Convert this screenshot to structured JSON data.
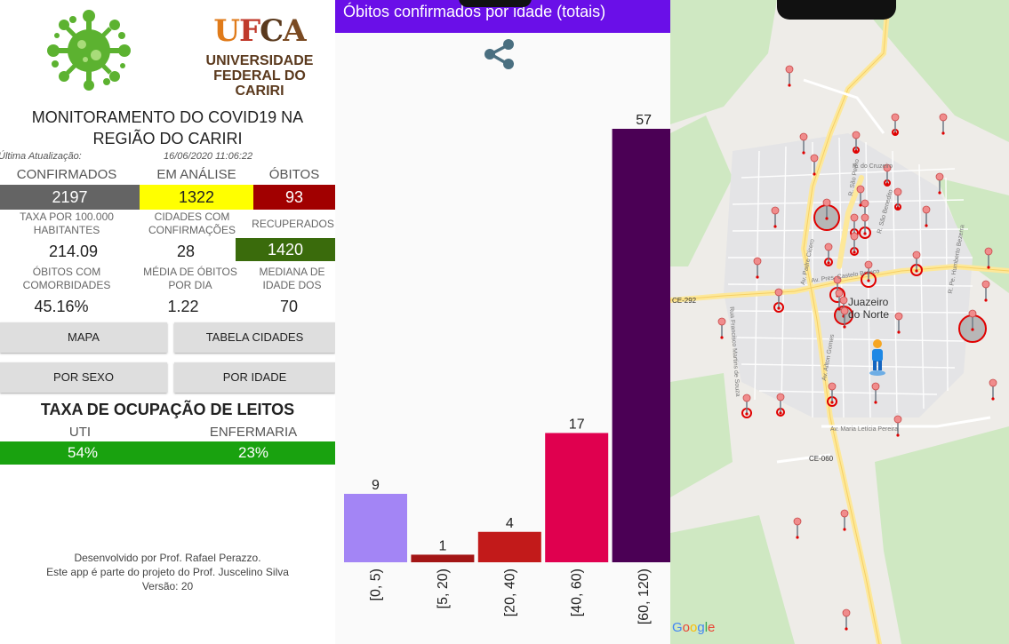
{
  "home": {
    "university_logo_text": "UFCA",
    "university_name_line1": "UNIVERSIDADE",
    "university_name_line2": "FEDERAL DO CARIRI",
    "title_line1": "MONITORAMENTO DO COVID19 NA",
    "title_line2": "REGIÃO DO CARIRI",
    "last_update_label": "Última Atualização:",
    "last_update_value": "16/06/2020 11:06:22",
    "confirmed_label": "CONFIRMADOS",
    "analysis_label": "EM ANÁLISE",
    "deaths_label": "ÓBITOS",
    "confirmed_value": "2197",
    "analysis_value": "1322",
    "deaths_value": "93",
    "rate_label_line1": "TAXA POR 100.000",
    "rate_label_line2": "HABITANTES",
    "cities_label_line1": "CIDADES COM",
    "cities_label_line2": "CONFIRMAÇÕES",
    "recovered_label": "RECUPERADOS",
    "rate_value": "214.09",
    "cities_value": "28",
    "recovered_value": "1420",
    "comorb_label_line1": "ÓBITOS COM",
    "comorb_label_line2": "COMORBIDADES",
    "avg_label_line1": "MÉDIA DE ÓBITOS",
    "avg_label_line2": "POR DIA",
    "median_label_line1": "MEDIANA DE",
    "median_label_line2": "IDADE DOS",
    "comorb_value": "45.16%",
    "avg_value": "1.22",
    "median_value": "70",
    "buttons": {
      "map": "MAPA",
      "city_table": "TABELA CIDADES",
      "by_sex": "POR SEXO",
      "by_age": "POR IDADE"
    },
    "beds_title": "TAXA DE OCUPAÇÃO DE LEITOS",
    "icu_label": "UTI",
    "ward_label": "ENFERMARIA",
    "icu_value": "54%",
    "ward_value": "23%",
    "footer_line1": "Desenvolvido por Prof. Rafael Perazzo.",
    "footer_line2": "Este app é parte do projeto do Prof. Juscelino Silva",
    "footer_line3": "Versão: 20",
    "colors": {
      "confirmed": "#646464",
      "analysis": "#ffff00",
      "deaths": "#a10000",
      "recovered": "#3a6b0c",
      "beds": "#19a20f"
    }
  },
  "chart_screen": {
    "header_title": "Óbitos confirmados por idade (totais)",
    "share_icon": "share-icon"
  },
  "chart_data": {
    "type": "bar",
    "title": "Óbitos confirmados por idade (totais)",
    "categories": [
      "[0, 5)",
      "[5, 20)",
      "[20, 40)",
      "[40, 60)",
      "[60, 120)"
    ],
    "values": [
      9,
      1,
      4,
      17,
      57
    ],
    "colors": [
      "#a385f5",
      "#a31515",
      "#c21a1a",
      "#e0004f",
      "#4b0055"
    ],
    "ylim": [
      0,
      57
    ],
    "grid": false,
    "legend": "none"
  },
  "map": {
    "city_label_line1": "Juazeiro",
    "city_label_line2": "do Norte",
    "road_label_ce292": "CE-292",
    "road_label_ce060": "CE-060",
    "streets": [
      "R. do Cruzeiro",
      "R. São Pedro",
      "R. São Benedito",
      "Av. Padre Cícero",
      "Av. Pres. Castelo Branco",
      "Av. Maria Letícia Pereira",
      "R. Pe. Humberto Bezerra",
      "Rua Francisco Martins de Souza",
      "Av. Ailton Gomes"
    ],
    "attribution": "Google",
    "user_marker_icon": "person-icon"
  }
}
